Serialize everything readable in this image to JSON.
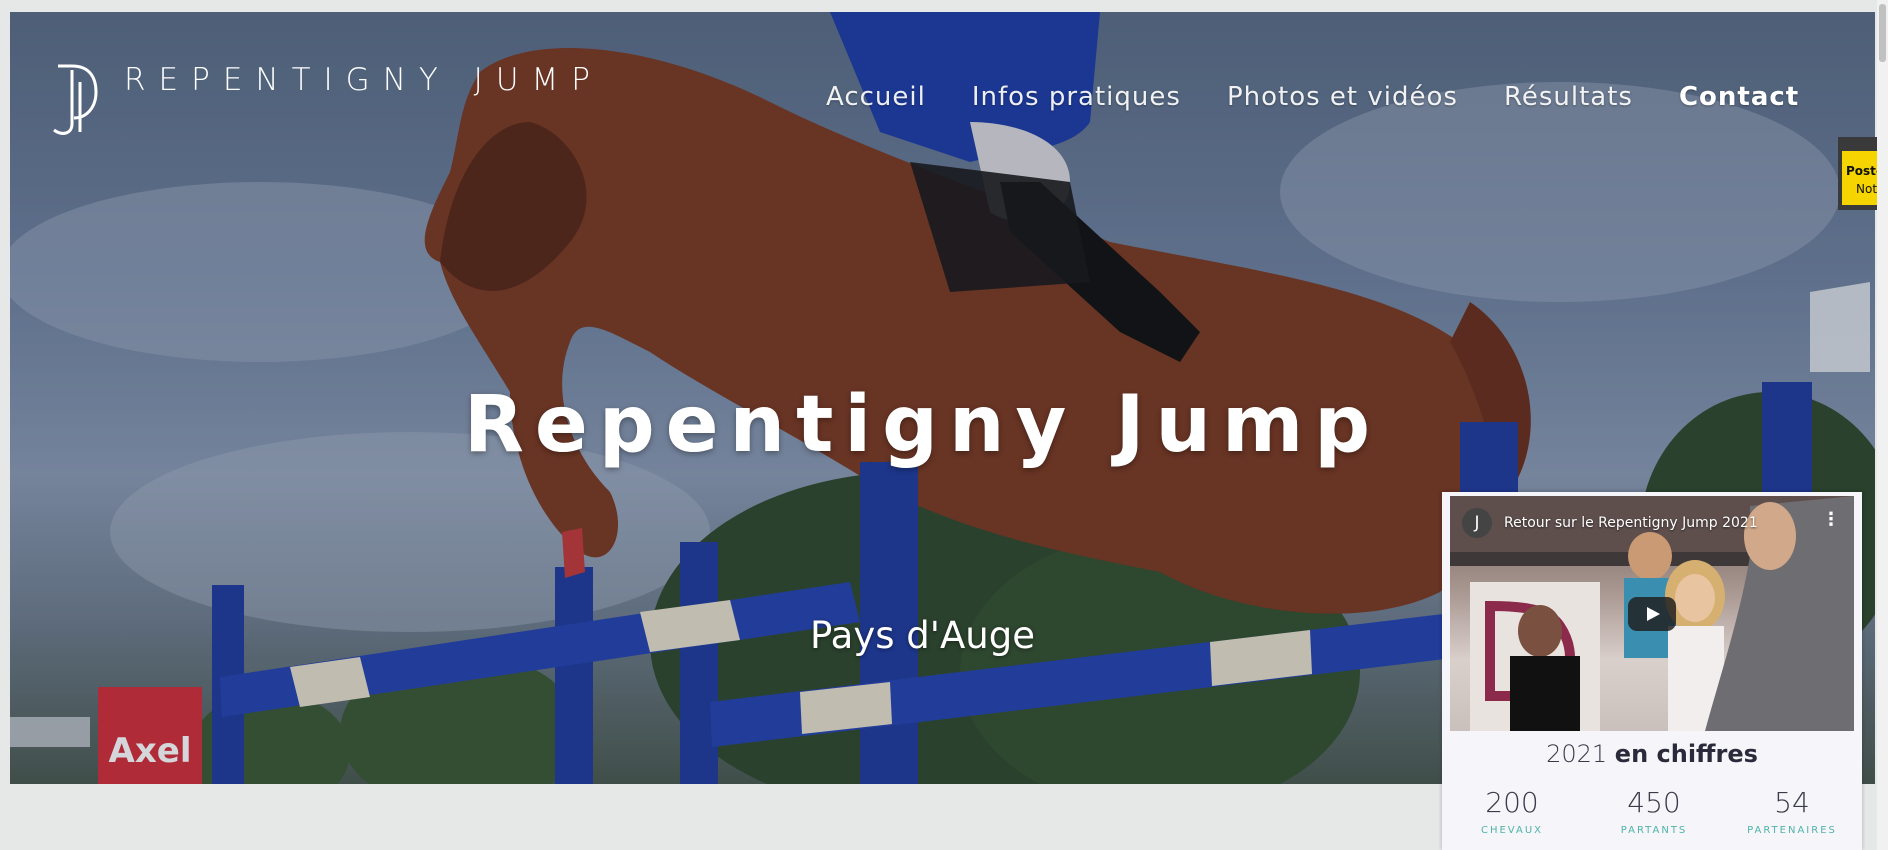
{
  "header": {
    "brand": "REPENTIGNY JUMP",
    "nav": [
      {
        "label": "Accueil"
      },
      {
        "label": "Infos pratiques"
      },
      {
        "label": "Photos et vidéos"
      },
      {
        "label": "Résultats"
      },
      {
        "label": "Contact"
      }
    ]
  },
  "hero": {
    "title": "Repentigny Jump",
    "subtitle": "Pays d'Auge",
    "banner_text": "Axel"
  },
  "widget": {
    "video": {
      "channel_initial": "J",
      "title": "Retour sur le Repentigny Jump 2021"
    },
    "stats_heading": {
      "year": "2021",
      "label": "en chiffres"
    },
    "stats": [
      {
        "value": "200",
        "label": "CHEVAUX"
      },
      {
        "value": "450",
        "label": "PARTANTS"
      },
      {
        "value": "54",
        "label": "PARTENAIRES"
      }
    ],
    "accent_color": "#4fb3a9"
  },
  "postit": {
    "line1": "Post-it",
    "line2": "Notes"
  }
}
